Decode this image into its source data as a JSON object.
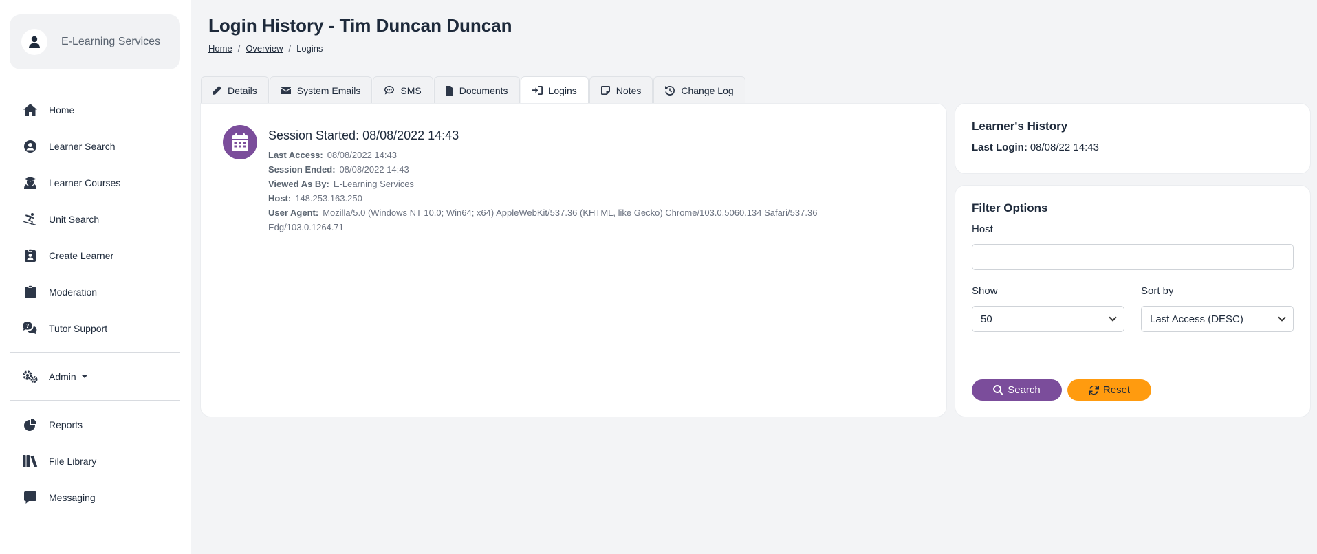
{
  "sidebar": {
    "brand": "E-Learning Services",
    "items": [
      {
        "label": "Home"
      },
      {
        "label": "Learner Search"
      },
      {
        "label": "Learner Courses"
      },
      {
        "label": "Unit Search"
      },
      {
        "label": "Create Learner"
      },
      {
        "label": "Moderation"
      },
      {
        "label": "Tutor Support"
      },
      {
        "label": "Admin"
      },
      {
        "label": "Reports"
      },
      {
        "label": "File Library"
      },
      {
        "label": "Messaging"
      }
    ]
  },
  "header": {
    "title": "Login History - Tim Duncan Duncan",
    "breadcrumb": [
      "Home",
      "Overview",
      "Logins"
    ]
  },
  "tabs": [
    {
      "label": "Details"
    },
    {
      "label": "System Emails"
    },
    {
      "label": "SMS"
    },
    {
      "label": "Documents"
    },
    {
      "label": "Logins"
    },
    {
      "label": "Notes"
    },
    {
      "label": "Change Log"
    }
  ],
  "session": {
    "title": "Session Started: 08/08/2022 14:43",
    "fields": [
      {
        "key": "Last Access:",
        "value": "08/08/2022 14:43"
      },
      {
        "key": "Session Ended:",
        "value": "08/08/2022 14:43"
      },
      {
        "key": "Viewed As By:",
        "value": "E-Learning Services"
      },
      {
        "key": "Host:",
        "value": "148.253.163.250"
      },
      {
        "key": "User Agent:",
        "value": "Mozilla/5.0 (Windows NT 10.0; Win64; x64) AppleWebKit/537.36 (KHTML, like Gecko) Chrome/103.0.5060.134 Safari/537.36 Edg/103.0.1264.71"
      }
    ]
  },
  "history": {
    "title": "Learner's History",
    "last_login_label": "Last Login:",
    "last_login_value": "08/08/22 14:43"
  },
  "filter": {
    "title": "Filter Options",
    "host_label": "Host",
    "host_value": "",
    "show_label": "Show",
    "show_value": "50",
    "sort_label": "Sort by",
    "sort_value": "Last Access (DESC)",
    "search_label": "Search",
    "reset_label": "Reset"
  },
  "colors": {
    "accent": "#7b4d9b",
    "reset": "#ff9b0f"
  }
}
